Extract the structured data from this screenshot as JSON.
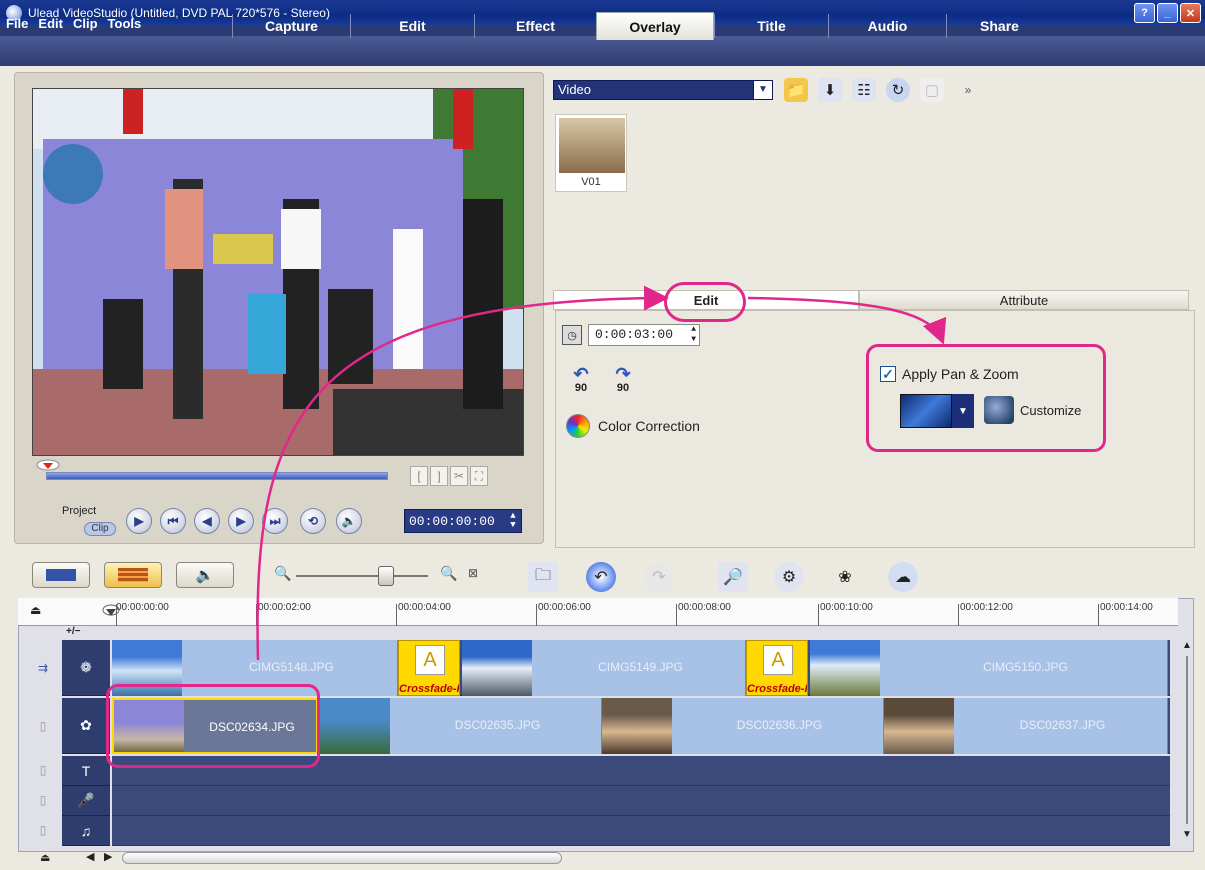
{
  "window": {
    "title": "Ulead VideoStudio (Untitled, DVD PAL 720*576 - Stereo)"
  },
  "menu": [
    "File",
    "Edit",
    "Clip",
    "Tools"
  ],
  "tabs": [
    "Capture",
    "Edit",
    "Effect",
    "Overlay",
    "Title",
    "Audio",
    "Share"
  ],
  "active_tab": "Overlay",
  "player": {
    "project_label": "Project",
    "clip_label": "Clip",
    "timecode": "00:00:00:00"
  },
  "library": {
    "category": "Video",
    "thumb_caption": "V01"
  },
  "options_tabs": {
    "edit": "Edit",
    "attribute": "Attribute"
  },
  "edit_options": {
    "duration": "0:00:03:00",
    "rotate_left": "90",
    "rotate_right": "90",
    "color_correction": "Color Correction",
    "apply_pan_zoom": "Apply Pan & Zoom",
    "customize": "Customize"
  },
  "timeline": {
    "track_toggle": "+/−",
    "ruler": [
      "00:00:00:00",
      "00:00:02:00",
      "00:00:04:00",
      "00:00:06:00",
      "00:00:08:00",
      "00:00:10:00",
      "00:00:12:00",
      "00:00:14:00"
    ],
    "video_clips": [
      "CIMG5148.JPG",
      "CIMG5149.JPG",
      "CIMG5150.JPG"
    ],
    "transition_label": "Crossfade-F",
    "overlay_clips": [
      "DSC02634.JPG",
      "DSC02635.JPG",
      "DSC02636.JPG",
      "DSC02637.JPG"
    ]
  },
  "colors": {
    "annotation": "#e0288a",
    "titlebar": "#0b2b84",
    "clip": "#a8c1e6"
  }
}
